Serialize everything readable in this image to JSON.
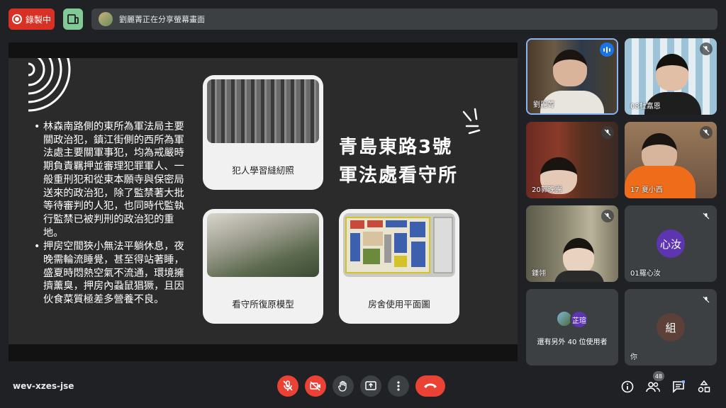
{
  "top": {
    "record_label": "錄製中",
    "share_text": "劉麗菁正在分享螢幕畫面"
  },
  "slide": {
    "title_line1": "青島東路3號",
    "title_line2": "軍法處看守所",
    "bullets": [
      "林森南路側的東所為軍法局主要關政治犯，鎮江街側的西所為軍法處主要關軍事犯，均為戒嚴時期負責羈押並審理犯罪軍人、一般重刑犯和從東本願寺與保密局送來的政治犯，除了監禁著大批等待審判的人犯，也同時代監執行監禁已被判刑的政治犯的重地。",
      "押房空間狹小無法平躺休息，夜晚需輪流睡覺，甚至得站著睡，盛夏時悶熱空氣不流通，環境擁擠薰臭，押房內蝨鼠猖獗，且因伙食菜質極差多營養不良。"
    ],
    "cards": [
      {
        "caption": "犯人學習縫紉照"
      },
      {
        "caption": "看守所復原模型"
      },
      {
        "caption": "房舍使用平面圖"
      }
    ]
  },
  "participants": [
    {
      "name": "劉麗菁",
      "state": "speaking"
    },
    {
      "name": "08杜嘉恩",
      "state": "muted"
    },
    {
      "name": "20郭晚霈",
      "state": "muted"
    },
    {
      "name": "17 夏小西",
      "state": "muted"
    },
    {
      "name": "鍾翎",
      "state": "muted"
    },
    {
      "name": "01羅心汝",
      "state": "muted",
      "avatar": "心汝",
      "avatar_color": "#5e35b1"
    },
    {
      "name": "還有另外 40 位使用者",
      "avatar": "芷瑄",
      "avatar_color": "#5e35b1"
    },
    {
      "name": "你",
      "state": "muted",
      "avatar": "組",
      "avatar_color": "#5d4037"
    }
  ],
  "bottom": {
    "meeting_code": "wev-xzes-jse",
    "people_count": "48"
  },
  "colors": {
    "record_red": "#d93025",
    "end_call_red": "#ea4335",
    "accent_blue": "#1a73e8",
    "tile_bg": "#3c4043"
  }
}
